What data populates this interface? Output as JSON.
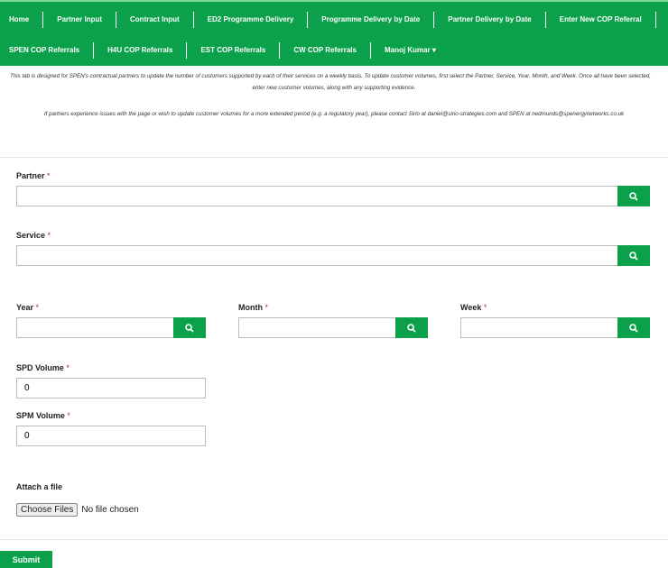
{
  "nav": {
    "row1": [
      "Home",
      "Partner Input",
      "Contract Input",
      "ED2 Programme Delivery",
      "Programme Delivery by Date",
      "Partner Delivery by Date",
      "Enter New COP Referral"
    ],
    "row2": [
      "SPEN COP Referrals",
      "H4U COP Referrals",
      "EST COP Referrals",
      "CW COP Referrals"
    ],
    "user": "Manoj Kumar ▾"
  },
  "info": {
    "line1": "This tab is designed for SPEN's contractual partners to update the number of customers supported by each of their services on a weekly basis. To update customer volumes, first select the Partner, Service, Year, Month, and Week. Once all have been selected,",
    "line2": "enter new customer volumes, along with any supporting evidence.",
    "line3": "If partners experience issues with the page or wish to update customer volumes for a more extended period (e.g. a regulatory year), please contact Sirio at daniel@sirio-strategies.com and SPEN at nedmunds@spenergynetworks.co.uk"
  },
  "form": {
    "required_mark": "*",
    "partner": {
      "label": "Partner",
      "value": ""
    },
    "service": {
      "label": "Service",
      "value": ""
    },
    "year": {
      "label": "Year",
      "value": ""
    },
    "month": {
      "label": "Month",
      "value": ""
    },
    "week": {
      "label": "Week",
      "value": ""
    },
    "spd": {
      "label": "SPD Volume",
      "value": "0"
    },
    "spm": {
      "label": "SPM Volume",
      "value": "0"
    },
    "attach": {
      "label": "Attach a file",
      "button": "Choose Files",
      "status": "No file chosen"
    },
    "submit": "Submit"
  },
  "colors": {
    "brand": "#0aa14a"
  },
  "icons": {
    "lookup": "search-icon"
  }
}
